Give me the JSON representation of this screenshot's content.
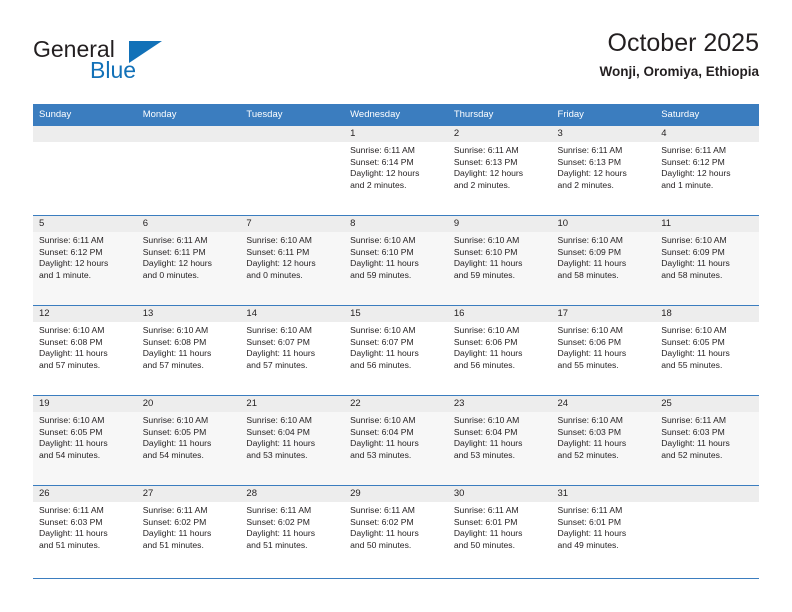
{
  "brand": {
    "name_top": "General",
    "name_bottom": "Blue",
    "triangle_color": "#1271b8",
    "text_color": "#231f20"
  },
  "header": {
    "title": "October 2025",
    "subtitle": "Wonji, Oromiya, Ethiopia"
  },
  "theme": {
    "header_blue": "#3b7dbf",
    "daynum_gray": "#ededed",
    "row_alt_gray": "#f7f7f7",
    "text": "#231f20"
  },
  "weekday_headers": [
    "Sunday",
    "Monday",
    "Tuesday",
    "Wednesday",
    "Thursday",
    "Friday",
    "Saturday"
  ],
  "labels": {
    "sunrise_prefix": "Sunrise:",
    "sunset_prefix": "Sunset:",
    "daylight_prefix": "Daylight:"
  },
  "weeks": [
    [
      {
        "day": "",
        "empty": true
      },
      {
        "day": "",
        "empty": true
      },
      {
        "day": "",
        "empty": true
      },
      {
        "day": "1",
        "sunrise": "Sunrise: 6:11 AM",
        "sunset": "Sunset: 6:14 PM",
        "daylight_line1": "Daylight: 12 hours",
        "daylight_line2": "and 2 minutes."
      },
      {
        "day": "2",
        "sunrise": "Sunrise: 6:11 AM",
        "sunset": "Sunset: 6:13 PM",
        "daylight_line1": "Daylight: 12 hours",
        "daylight_line2": "and 2 minutes."
      },
      {
        "day": "3",
        "sunrise": "Sunrise: 6:11 AM",
        "sunset": "Sunset: 6:13 PM",
        "daylight_line1": "Daylight: 12 hours",
        "daylight_line2": "and 2 minutes."
      },
      {
        "day": "4",
        "sunrise": "Sunrise: 6:11 AM",
        "sunset": "Sunset: 6:12 PM",
        "daylight_line1": "Daylight: 12 hours",
        "daylight_line2": "and 1 minute."
      }
    ],
    [
      {
        "day": "5",
        "sunrise": "Sunrise: 6:11 AM",
        "sunset": "Sunset: 6:12 PM",
        "daylight_line1": "Daylight: 12 hours",
        "daylight_line2": "and 1 minute."
      },
      {
        "day": "6",
        "sunrise": "Sunrise: 6:11 AM",
        "sunset": "Sunset: 6:11 PM",
        "daylight_line1": "Daylight: 12 hours",
        "daylight_line2": "and 0 minutes."
      },
      {
        "day": "7",
        "sunrise": "Sunrise: 6:10 AM",
        "sunset": "Sunset: 6:11 PM",
        "daylight_line1": "Daylight: 12 hours",
        "daylight_line2": "and 0 minutes."
      },
      {
        "day": "8",
        "sunrise": "Sunrise: 6:10 AM",
        "sunset": "Sunset: 6:10 PM",
        "daylight_line1": "Daylight: 11 hours",
        "daylight_line2": "and 59 minutes."
      },
      {
        "day": "9",
        "sunrise": "Sunrise: 6:10 AM",
        "sunset": "Sunset: 6:10 PM",
        "daylight_line1": "Daylight: 11 hours",
        "daylight_line2": "and 59 minutes."
      },
      {
        "day": "10",
        "sunrise": "Sunrise: 6:10 AM",
        "sunset": "Sunset: 6:09 PM",
        "daylight_line1": "Daylight: 11 hours",
        "daylight_line2": "and 58 minutes."
      },
      {
        "day": "11",
        "sunrise": "Sunrise: 6:10 AM",
        "sunset": "Sunset: 6:09 PM",
        "daylight_line1": "Daylight: 11 hours",
        "daylight_line2": "and 58 minutes."
      }
    ],
    [
      {
        "day": "12",
        "sunrise": "Sunrise: 6:10 AM",
        "sunset": "Sunset: 6:08 PM",
        "daylight_line1": "Daylight: 11 hours",
        "daylight_line2": "and 57 minutes."
      },
      {
        "day": "13",
        "sunrise": "Sunrise: 6:10 AM",
        "sunset": "Sunset: 6:08 PM",
        "daylight_line1": "Daylight: 11 hours",
        "daylight_line2": "and 57 minutes."
      },
      {
        "day": "14",
        "sunrise": "Sunrise: 6:10 AM",
        "sunset": "Sunset: 6:07 PM",
        "daylight_line1": "Daylight: 11 hours",
        "daylight_line2": "and 57 minutes."
      },
      {
        "day": "15",
        "sunrise": "Sunrise: 6:10 AM",
        "sunset": "Sunset: 6:07 PM",
        "daylight_line1": "Daylight: 11 hours",
        "daylight_line2": "and 56 minutes."
      },
      {
        "day": "16",
        "sunrise": "Sunrise: 6:10 AM",
        "sunset": "Sunset: 6:06 PM",
        "daylight_line1": "Daylight: 11 hours",
        "daylight_line2": "and 56 minutes."
      },
      {
        "day": "17",
        "sunrise": "Sunrise: 6:10 AM",
        "sunset": "Sunset: 6:06 PM",
        "daylight_line1": "Daylight: 11 hours",
        "daylight_line2": "and 55 minutes."
      },
      {
        "day": "18",
        "sunrise": "Sunrise: 6:10 AM",
        "sunset": "Sunset: 6:05 PM",
        "daylight_line1": "Daylight: 11 hours",
        "daylight_line2": "and 55 minutes."
      }
    ],
    [
      {
        "day": "19",
        "sunrise": "Sunrise: 6:10 AM",
        "sunset": "Sunset: 6:05 PM",
        "daylight_line1": "Daylight: 11 hours",
        "daylight_line2": "and 54 minutes."
      },
      {
        "day": "20",
        "sunrise": "Sunrise: 6:10 AM",
        "sunset": "Sunset: 6:05 PM",
        "daylight_line1": "Daylight: 11 hours",
        "daylight_line2": "and 54 minutes."
      },
      {
        "day": "21",
        "sunrise": "Sunrise: 6:10 AM",
        "sunset": "Sunset: 6:04 PM",
        "daylight_line1": "Daylight: 11 hours",
        "daylight_line2": "and 53 minutes."
      },
      {
        "day": "22",
        "sunrise": "Sunrise: 6:10 AM",
        "sunset": "Sunset: 6:04 PM",
        "daylight_line1": "Daylight: 11 hours",
        "daylight_line2": "and 53 minutes."
      },
      {
        "day": "23",
        "sunrise": "Sunrise: 6:10 AM",
        "sunset": "Sunset: 6:04 PM",
        "daylight_line1": "Daylight: 11 hours",
        "daylight_line2": "and 53 minutes."
      },
      {
        "day": "24",
        "sunrise": "Sunrise: 6:10 AM",
        "sunset": "Sunset: 6:03 PM",
        "daylight_line1": "Daylight: 11 hours",
        "daylight_line2": "and 52 minutes."
      },
      {
        "day": "25",
        "sunrise": "Sunrise: 6:11 AM",
        "sunset": "Sunset: 6:03 PM",
        "daylight_line1": "Daylight: 11 hours",
        "daylight_line2": "and 52 minutes."
      }
    ],
    [
      {
        "day": "26",
        "sunrise": "Sunrise: 6:11 AM",
        "sunset": "Sunset: 6:03 PM",
        "daylight_line1": "Daylight: 11 hours",
        "daylight_line2": "and 51 minutes."
      },
      {
        "day": "27",
        "sunrise": "Sunrise: 6:11 AM",
        "sunset": "Sunset: 6:02 PM",
        "daylight_line1": "Daylight: 11 hours",
        "daylight_line2": "and 51 minutes."
      },
      {
        "day": "28",
        "sunrise": "Sunrise: 6:11 AM",
        "sunset": "Sunset: 6:02 PM",
        "daylight_line1": "Daylight: 11 hours",
        "daylight_line2": "and 51 minutes."
      },
      {
        "day": "29",
        "sunrise": "Sunrise: 6:11 AM",
        "sunset": "Sunset: 6:02 PM",
        "daylight_line1": "Daylight: 11 hours",
        "daylight_line2": "and 50 minutes."
      },
      {
        "day": "30",
        "sunrise": "Sunrise: 6:11 AM",
        "sunset": "Sunset: 6:01 PM",
        "daylight_line1": "Daylight: 11 hours",
        "daylight_line2": "and 50 minutes."
      },
      {
        "day": "31",
        "sunrise": "Sunrise: 6:11 AM",
        "sunset": "Sunset: 6:01 PM",
        "daylight_line1": "Daylight: 11 hours",
        "daylight_line2": "and 49 minutes."
      },
      {
        "day": "",
        "empty": true
      }
    ]
  ]
}
